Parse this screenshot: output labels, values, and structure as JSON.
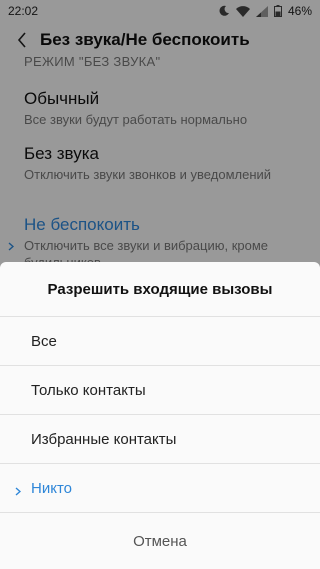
{
  "status_bar": {
    "time": "22:02",
    "battery": "46%"
  },
  "header": {
    "title": "Без звука/Не беспокоить"
  },
  "section": {
    "label": "РЕЖИМ \"БЕЗ ЗВУКА\""
  },
  "modes": [
    {
      "title": "Обычный",
      "desc": "Все звуки будут работать нормально"
    },
    {
      "title": "Без звука",
      "desc": "Отключить звуки звонков и уведомлений"
    },
    {
      "title": "Не беспокоить",
      "desc": "Отключить все звуки и вибрацию, кроме будильников"
    }
  ],
  "dialog": {
    "title": "Разрешить входящие вызовы",
    "options": [
      "Все",
      "Только контакты",
      "Избранные контакты",
      "Никто"
    ],
    "selected": "Никто",
    "cancel_label": "Отмена"
  },
  "colors": {
    "accent": "#2e86d8"
  }
}
